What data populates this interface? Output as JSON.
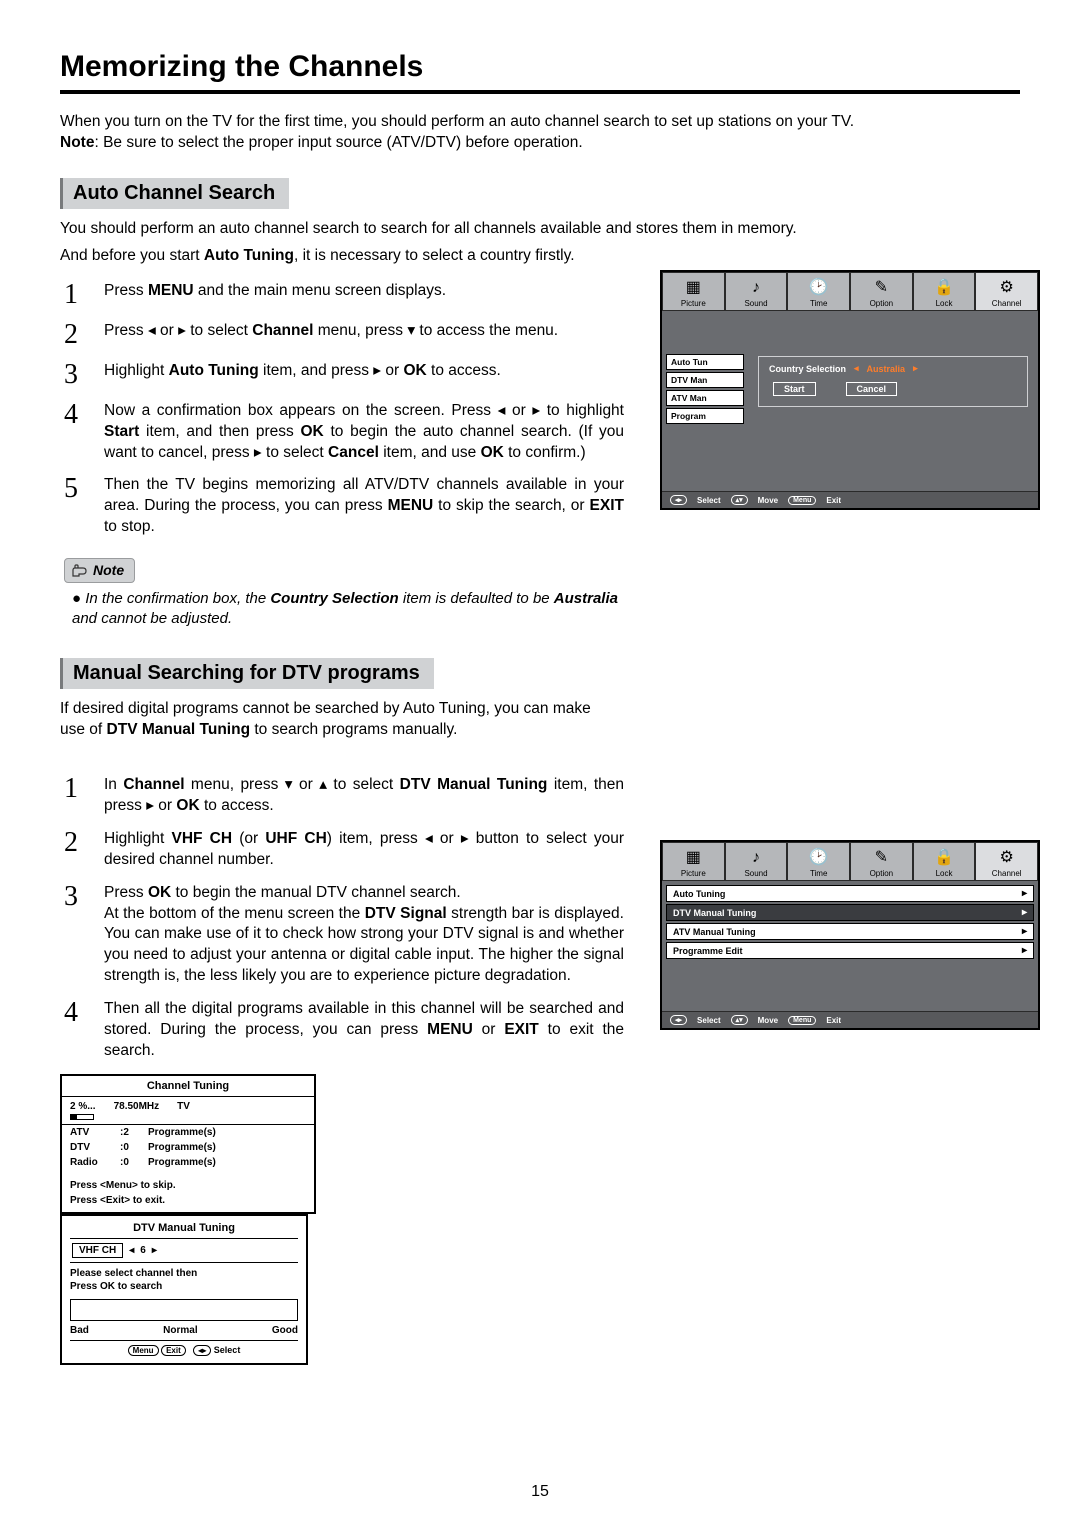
{
  "page_title": "Memorizing the Channels",
  "intro_line1": "When you turn on the TV for the first time, you should perform an auto channel search to set up stations on your TV.",
  "intro_note_label": "Note",
  "intro_note_text": ": Be sure to select the proper input source (ATV/DTV) before operation.",
  "section1": {
    "heading": "Auto Channel Search",
    "p1": "You should perform an auto channel search to search for all channels available and stores them in memory.",
    "p2_a": "And before you start ",
    "p2_b": "Auto Tuning",
    "p2_c": ", it is necessary to select a country firstly.",
    "steps": [
      {
        "n": "1",
        "html": "Press <b>MENU</b> and the main menu screen displays."
      },
      {
        "n": "2",
        "html": "Press <span class='arrow'>◂</span> or <span class='arrow'>▸</span> to select <b>Channel</b> menu, press <span class='arrow'>▾</span> to access the menu."
      },
      {
        "n": "3",
        "html": "Highlight <b>Auto Tuning</b> item, and press <span class='arrow'>▸</span> or <b>OK</b> to access."
      },
      {
        "n": "4",
        "html": "Now a confirmation box appears on the screen. Press <span class='arrow'>◂</span> or <span class='arrow'>▸</span> to highlight <b>Start</b> item, and then press <b>OK</b> to begin the auto channel search. (If you want to cancel, press <span class='arrow'>▸</span> to select <b>Cancel</b> item, and use <b>OK</b> to confirm.)"
      },
      {
        "n": "5",
        "html": "Then the TV begins memorizing all ATV/DTV channels available in your area. During the process, you can press <b>MENU</b> to skip the search, or <b>EXIT</b> to stop."
      }
    ],
    "note_label": "Note",
    "note_html": "In the confirmation box, the <b>Country Selection</b> item is defaulted to be <b>Australia</b> and cannot be adjusted."
  },
  "section2": {
    "heading": "Manual Searching for DTV programs",
    "p1_a": "If desired digital programs cannot be searched by Auto Tuning, you can make use of ",
    "p1_b": "DTV Manual Tuning",
    "p1_c": " to search programs manually.",
    "steps": [
      {
        "n": "1",
        "html": "In <b>Channel</b> menu, press <span class='arrow'>▾</span> or <span class='arrow'>▴</span> to select <b>DTV Manual Tuning</b> item, then press <span class='arrow'>▸</span> or <b>OK</b> to access."
      },
      {
        "n": "2",
        "html": "Highlight <b>VHF CH</b> (or <b>UHF CH</b>) item, press <span class='arrow'>◂</span> or <span class='arrow'>▸</span> button to select your desired channel number."
      },
      {
        "n": "3",
        "html": "Press <b>OK</b> to begin the manual DTV channel search.<br>At the bottom of the menu screen the <b>DTV Signal</b> strength bar is displayed. You can make use of it to check how strong your DTV signal is and whether you need to adjust your antenna or digital cable input. The higher the signal strength is, the less likely you are to experience picture degradation."
      },
      {
        "n": "4",
        "html": "Then all the digital programs available in this channel will be searched and stored. During the process, you can press <b>MENU</b> or <b>EXIT</b> to exit the search."
      }
    ]
  },
  "tv_tabs": [
    "Picture",
    "Sound",
    "Time",
    "Option",
    "Lock",
    "Channel"
  ],
  "tv_tab_icons": [
    "▦",
    "♪",
    "🕑",
    "✎",
    "🔒",
    "⚙"
  ],
  "tv1": {
    "side": [
      "Auto Tun",
      "DTV Man",
      "ATV Man",
      "Program"
    ],
    "popup_label": "Country Selection",
    "popup_value": "Australia",
    "start": "Start",
    "cancel": "Cancel"
  },
  "footer": {
    "select": "Select",
    "move": "Move",
    "menu": "Menu",
    "exit": "Exit"
  },
  "tv2": {
    "title": "Channel  Tuning",
    "percent": "2  %...",
    "freq": "78.50MHz",
    "mode": "TV",
    "rows": [
      {
        "a": "ATV",
        "b": ":2",
        "c": "Programme(s)"
      },
      {
        "a": "DTV",
        "b": ":0",
        "c": "Programme(s)"
      },
      {
        "a": "Radio",
        "b": ":0",
        "c": "Programme(s)"
      }
    ],
    "skip": "Press <Menu> to skip.",
    "exit": "Press <Exit> to exit."
  },
  "tv3_items": [
    "Auto Tuning",
    "DTV Manual Tuning",
    "ATV Manual Tuning",
    "Programme Edit"
  ],
  "tv4": {
    "title": "DTV Manual Tuning",
    "band": "VHF  CH",
    "num": "6",
    "msg1": "Please select channel then",
    "msg2": "Press OK to search",
    "bad": "Bad",
    "normal": "Normal",
    "good": "Good",
    "select": "Select"
  },
  "page_number": "15"
}
